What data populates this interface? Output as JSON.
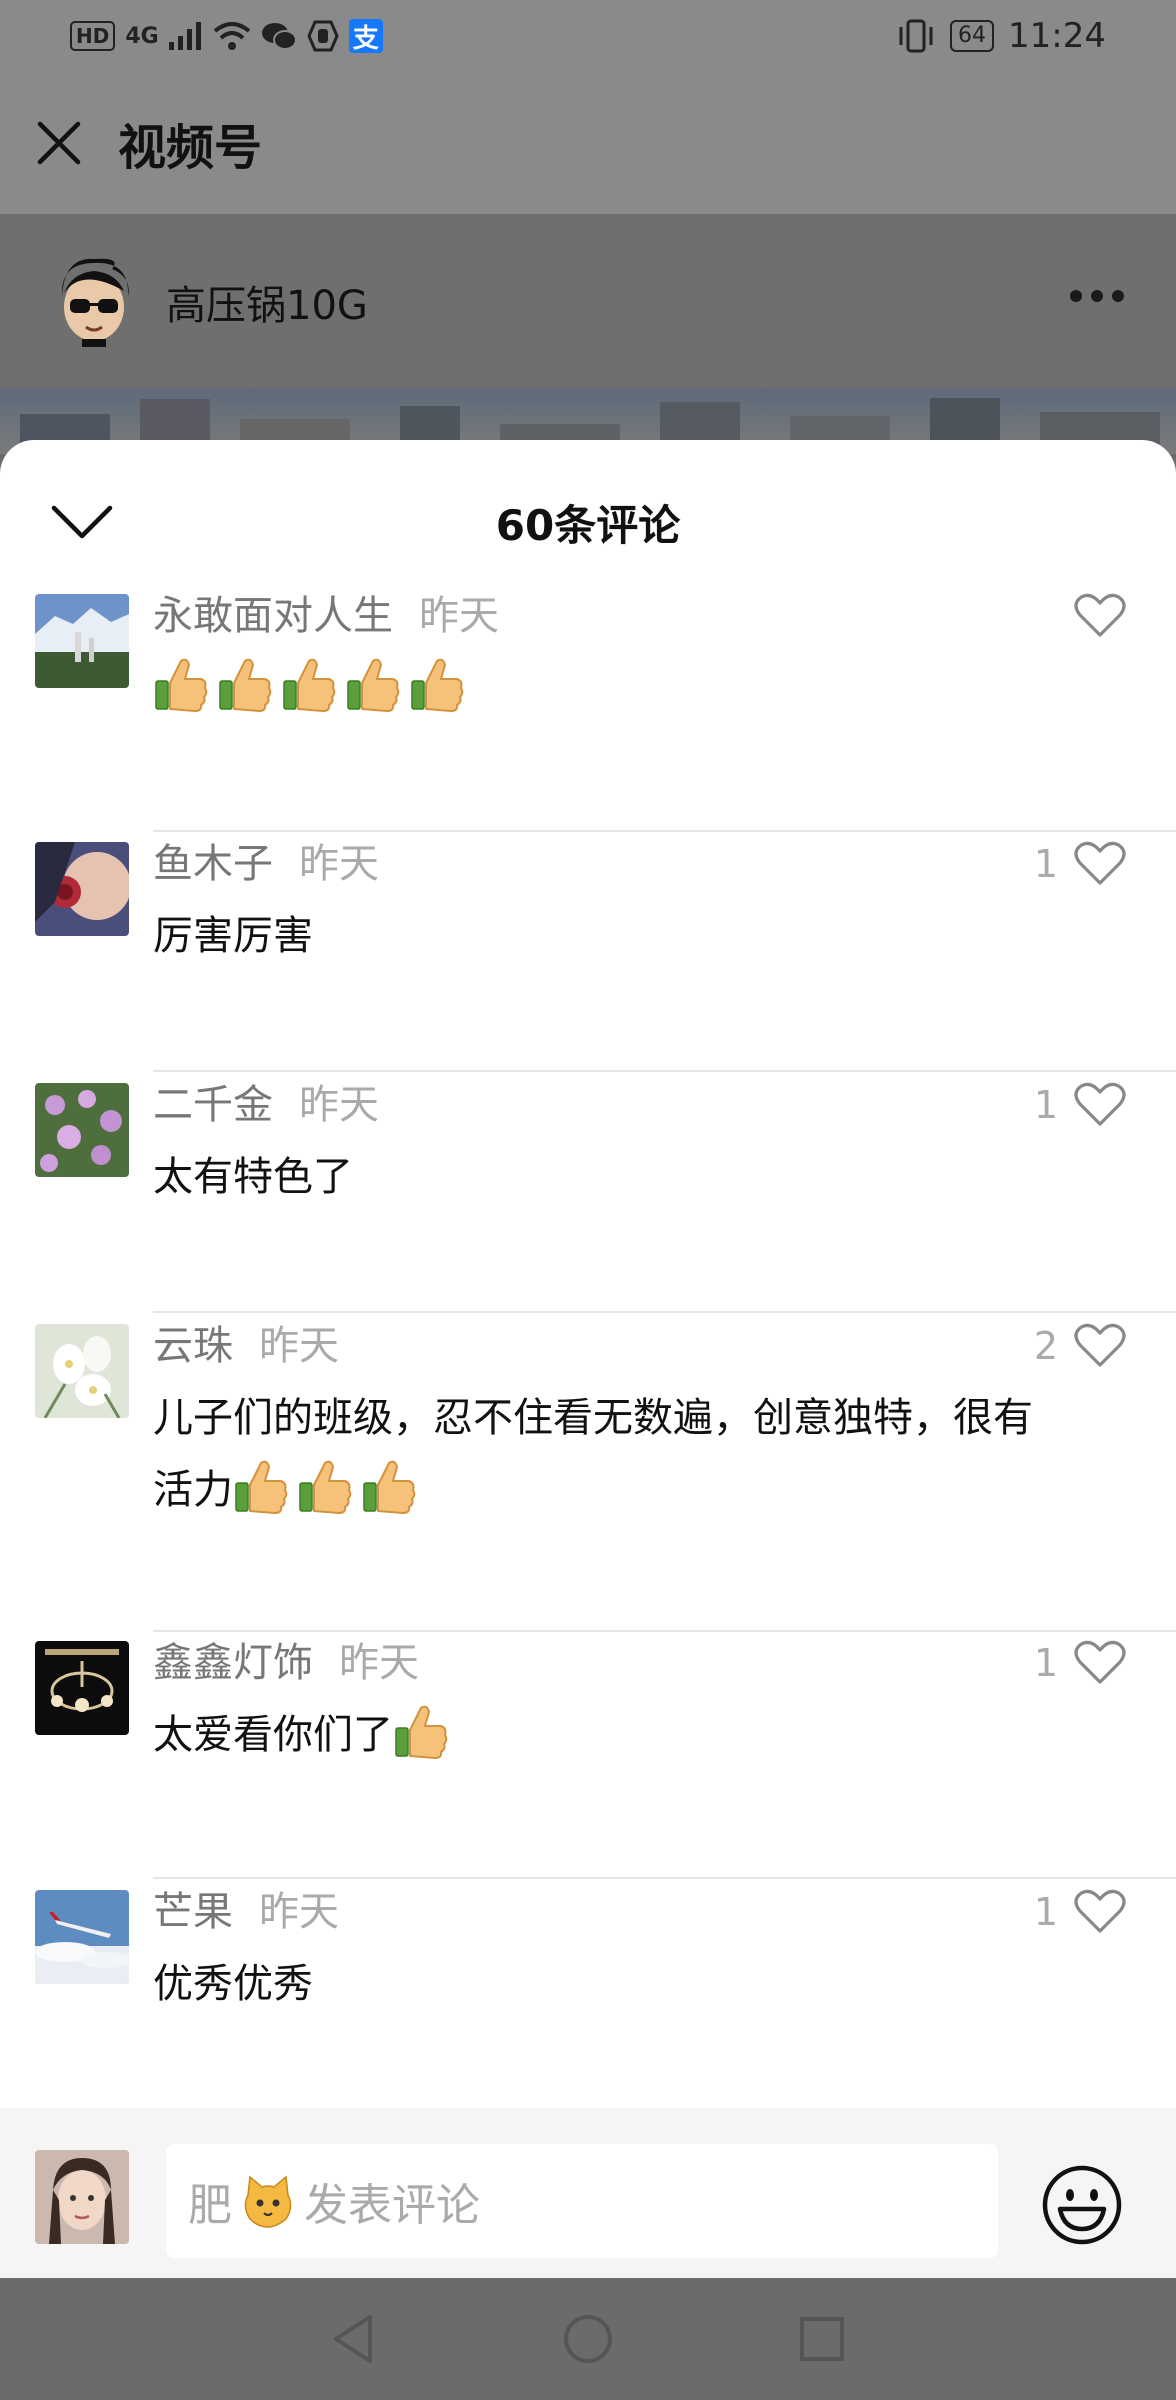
{
  "status_bar": {
    "hd": "HD",
    "network": "4G",
    "battery": "64",
    "time": "11:24"
  },
  "header": {
    "title": "视频号"
  },
  "author": {
    "name": "高压锅10G"
  },
  "comments_sheet": {
    "title": "60条评论",
    "comments": [
      {
        "name": "永敢面对人生",
        "time": "昨天",
        "text": "",
        "thumbs": 5,
        "likes": ""
      },
      {
        "name": "鱼木子",
        "time": "昨天",
        "text": "厉害厉害",
        "thumbs": 0,
        "likes": "1"
      },
      {
        "name": "二千金",
        "time": "昨天",
        "text": "太有特色了",
        "thumbs": 0,
        "likes": "1"
      },
      {
        "name": "云珠",
        "time": "昨天",
        "text": "儿子们的班级，忍不住看无数遍，创意独特，很有活力",
        "thumbs": 3,
        "likes": "2"
      },
      {
        "name": "鑫鑫灯饰",
        "time": "昨天",
        "text": "太爱看你们了",
        "thumbs": 1,
        "likes": "1"
      },
      {
        "name": "芒果",
        "time": "昨天",
        "text": "优秀优秀",
        "thumbs": 0,
        "likes": "1"
      }
    ]
  },
  "input_bar": {
    "prefix": "肥",
    "placeholder": "发表评论"
  },
  "colors": {
    "dim_overlay": "#6b6b6b",
    "name_gray": "#777777",
    "time_gray": "#aaaaaa",
    "sheet_bg": "#ffffff"
  }
}
